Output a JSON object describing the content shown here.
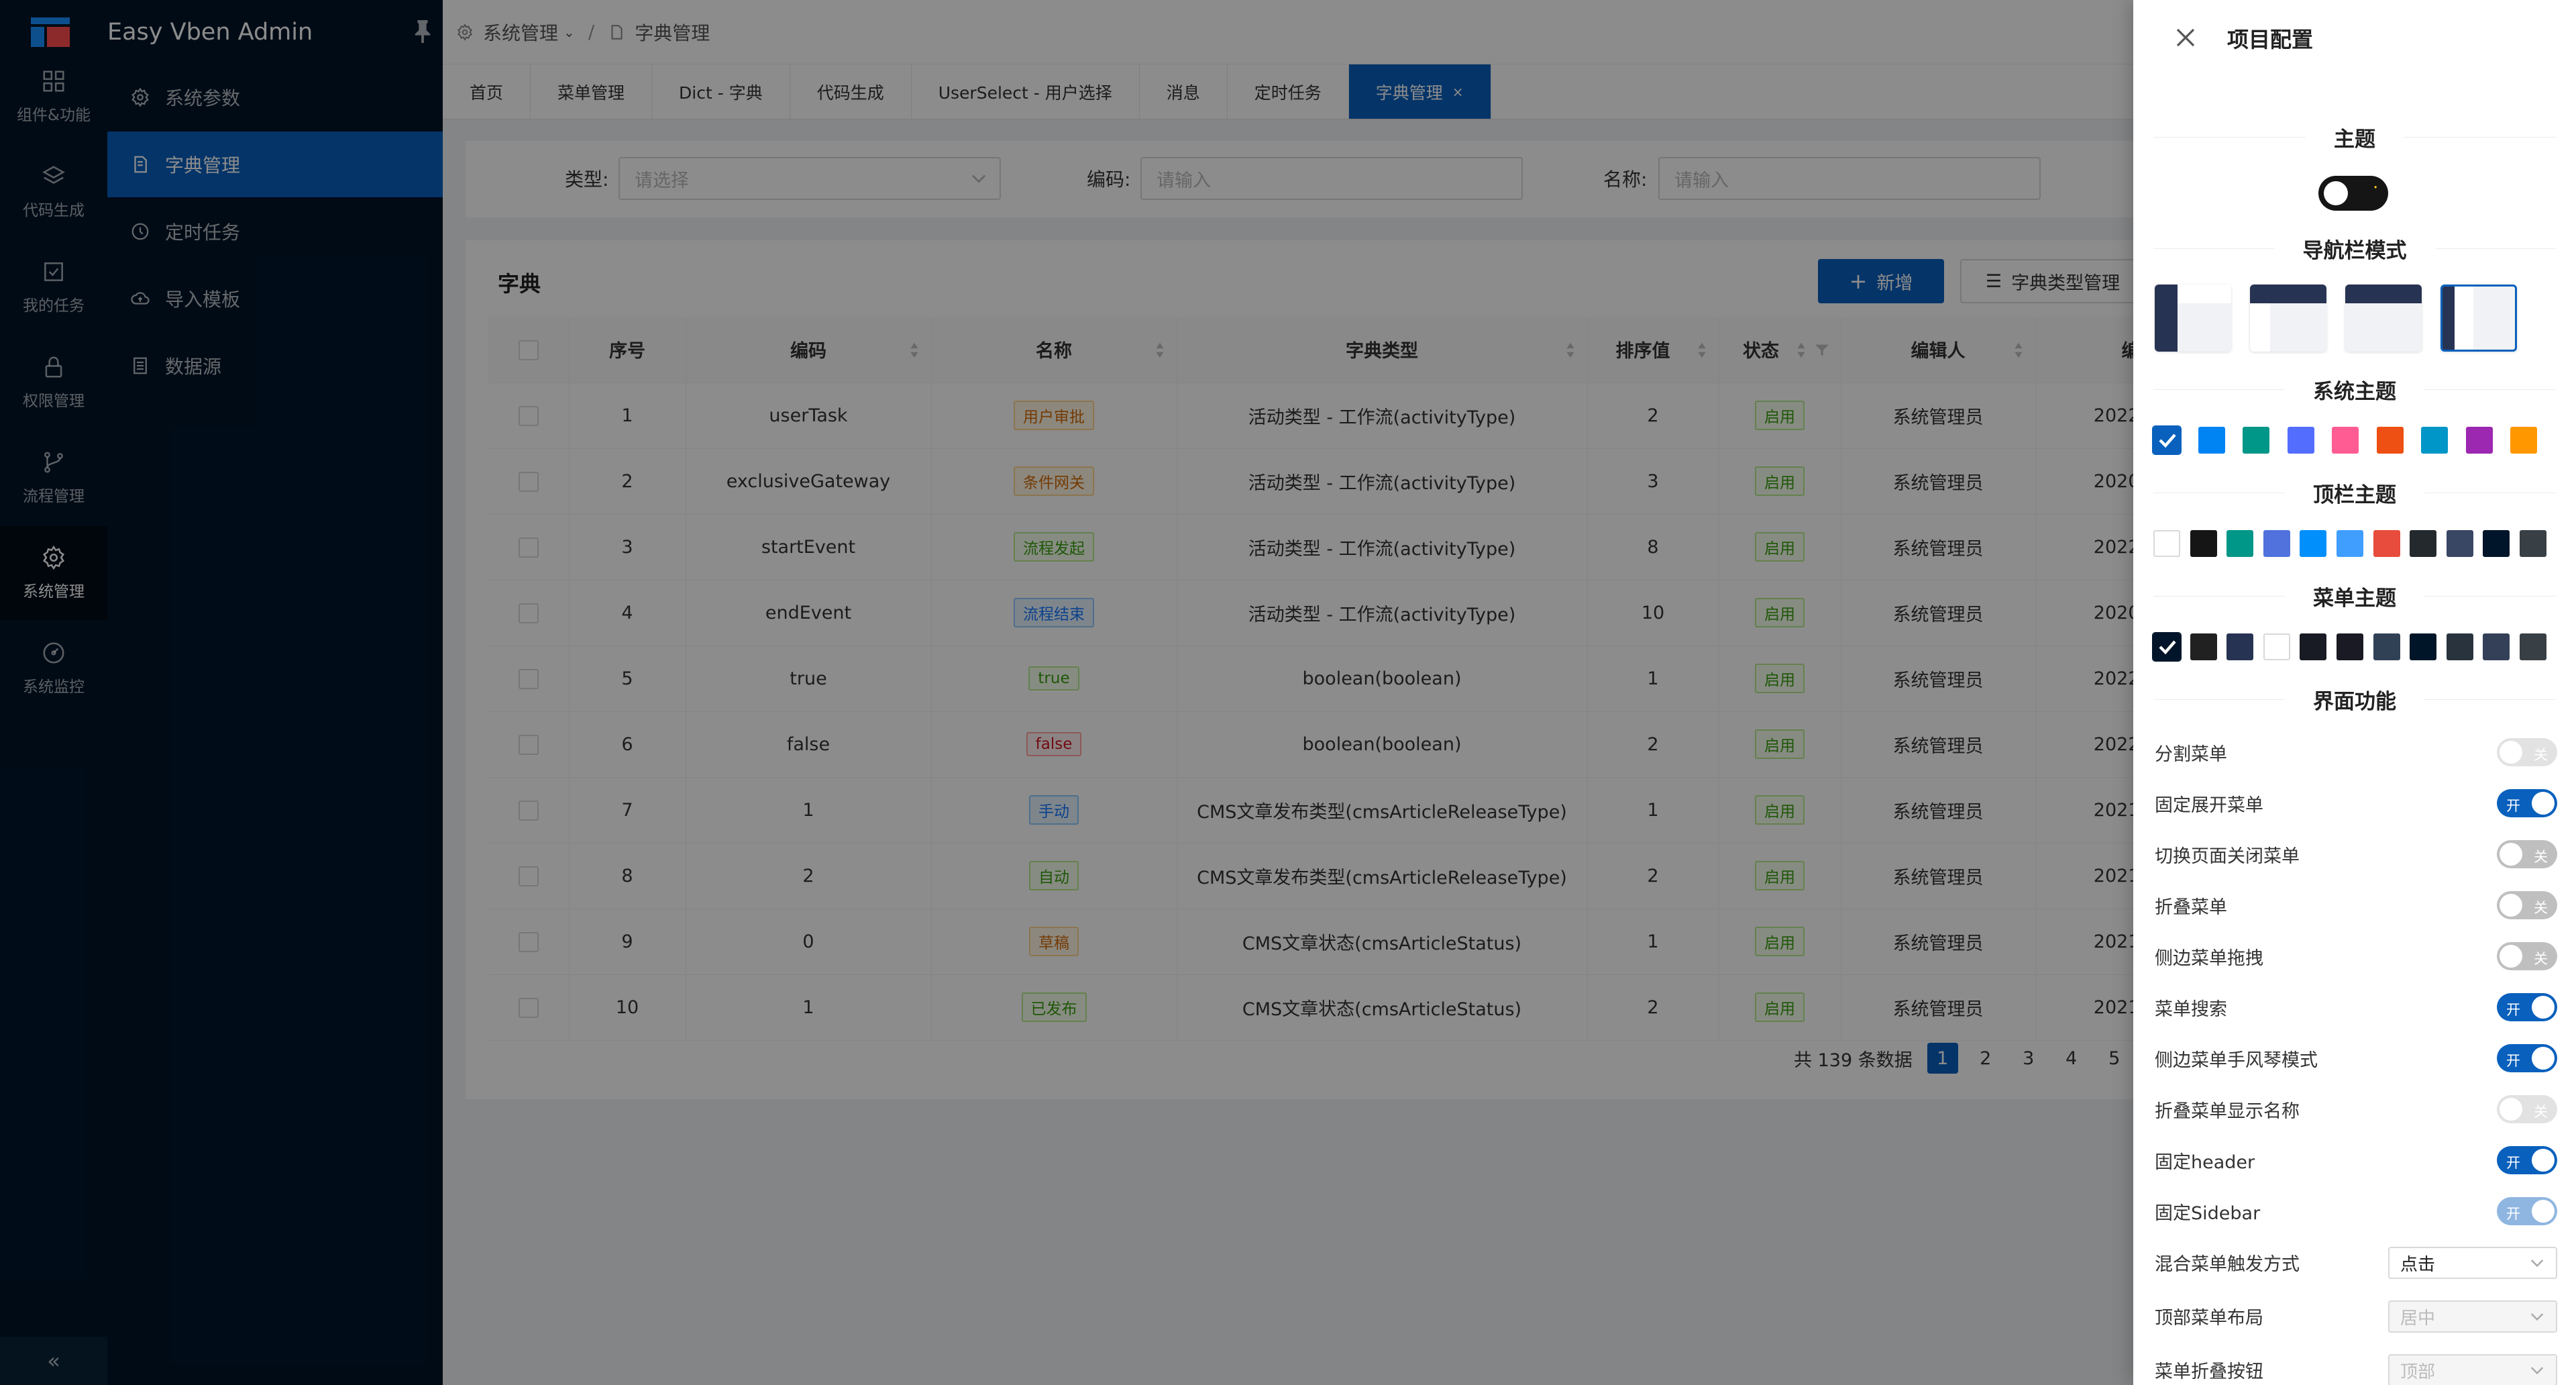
{
  "app": {
    "title": "Easy Vben Admin"
  },
  "rail": [
    {
      "label": "组件&功能",
      "icon": "grid-icon"
    },
    {
      "label": "代码生成",
      "icon": "layers-icon"
    },
    {
      "label": "我的任务",
      "icon": "checkbox-icon"
    },
    {
      "label": "权限管理",
      "icon": "lock-icon"
    },
    {
      "label": "流程管理",
      "icon": "branch-icon"
    },
    {
      "label": "系统管理",
      "icon": "gear-icon"
    },
    {
      "label": "系统监控",
      "icon": "dashboard-icon"
    }
  ],
  "submenu": [
    {
      "label": "系统参数"
    },
    {
      "label": "字典管理"
    },
    {
      "label": "定时任务"
    },
    {
      "label": "导入模板"
    },
    {
      "label": "数据源"
    }
  ],
  "breadcrumb": {
    "parent": "系统管理",
    "current": "字典管理",
    "separator": "/"
  },
  "tabs": [
    "首页",
    "菜单管理",
    "Dict - 字典",
    "代码生成",
    "UserSelect - 用户选择",
    "消息",
    "定时任务",
    "字典管理"
  ],
  "search": {
    "type_label": "类型:",
    "type_placeholder": "请选择",
    "code_label": "编码:",
    "code_placeholder": "请输入",
    "name_label": "名称:",
    "name_placeholder": "请输入"
  },
  "card": {
    "title": "字典",
    "add_button": "新增",
    "type_button": "字典类型管理"
  },
  "table": {
    "headers": [
      "序号",
      "编码",
      "名称",
      "字典类型",
      "排序值",
      "状态",
      "编辑人",
      "编"
    ],
    "rows": [
      {
        "no": "1",
        "code": "userTask",
        "name": "用户审批",
        "tag": "orange",
        "type": "活动类型 - 工作流(activityType)",
        "sort": "2",
        "status": "启用",
        "editor": "系统管理员",
        "date": "2022"
      },
      {
        "no": "2",
        "code": "exclusiveGateway",
        "name": "条件网关",
        "tag": "orange",
        "type": "活动类型 - 工作流(activityType)",
        "sort": "3",
        "status": "启用",
        "editor": "系统管理员",
        "date": "2020"
      },
      {
        "no": "3",
        "code": "startEvent",
        "name": "流程发起",
        "tag": "green",
        "type": "活动类型 - 工作流(activityType)",
        "sort": "8",
        "status": "启用",
        "editor": "系统管理员",
        "date": "2022"
      },
      {
        "no": "4",
        "code": "endEvent",
        "name": "流程结束",
        "tag": "blue",
        "type": "活动类型 - 工作流(activityType)",
        "sort": "10",
        "status": "启用",
        "editor": "系统管理员",
        "date": "2020"
      },
      {
        "no": "5",
        "code": "true",
        "name": "true",
        "tag": "green",
        "type": "boolean(boolean)",
        "sort": "1",
        "status": "启用",
        "editor": "系统管理员",
        "date": "2022"
      },
      {
        "no": "6",
        "code": "false",
        "name": "false",
        "tag": "red",
        "type": "boolean(boolean)",
        "sort": "2",
        "status": "启用",
        "editor": "系统管理员",
        "date": "2022"
      },
      {
        "no": "7",
        "code": "1",
        "name": "手动",
        "tag": "blue",
        "type": "CMS文章发布类型(cmsArticleReleaseType)",
        "sort": "1",
        "status": "启用",
        "editor": "系统管理员",
        "date": "2021"
      },
      {
        "no": "8",
        "code": "2",
        "name": "自动",
        "tag": "green",
        "type": "CMS文章发布类型(cmsArticleReleaseType)",
        "sort": "2",
        "status": "启用",
        "editor": "系统管理员",
        "date": "2021"
      },
      {
        "no": "9",
        "code": "0",
        "name": "草稿",
        "tag": "orange",
        "type": "CMS文章状态(cmsArticleStatus)",
        "sort": "1",
        "status": "启用",
        "editor": "系统管理员",
        "date": "2021"
      },
      {
        "no": "10",
        "code": "1",
        "name": "已发布",
        "tag": "green",
        "type": "CMS文章状态(cmsArticleStatus)",
        "sort": "2",
        "status": "启用",
        "editor": "系统管理员",
        "date": "2021"
      }
    ]
  },
  "pagination": {
    "total": "共 139 条数据",
    "pages": [
      "1",
      "2",
      "3",
      "4",
      "5"
    ],
    "current": "1"
  },
  "drawer": {
    "title": "项目配置",
    "sections": {
      "theme": "主题",
      "nav_mode": "导航栏模式",
      "system_theme": "系统主题",
      "header_theme": "顶栏主题",
      "menu_theme": "菜单主题",
      "features": "界面功能"
    },
    "system_colors": [
      "#0960bd",
      "#0084f4",
      "#009688",
      "#536dfe",
      "#ff5c93",
      "#ee4f12",
      "#0096c7",
      "#9c27b0",
      "#ff9800"
    ],
    "header_colors": [
      "#ffffff",
      "#151515",
      "#009688",
      "#5172dc",
      "#018ffb",
      "#409eff",
      "#e74c3c",
      "#24292e",
      "#394664",
      "#001529",
      "#383f45"
    ],
    "menu_colors": [
      "#001529",
      "#212121",
      "#273352",
      "#ffffff",
      "#191b24",
      "#191a23",
      "#304156",
      "#001628",
      "#28333e",
      "#344058",
      "#383f45"
    ],
    "options": [
      {
        "label": "分割菜单",
        "state": "关",
        "on": false,
        "disabled": true
      },
      {
        "label": "固定展开菜单",
        "state": "开",
        "on": true,
        "disabled": false
      },
      {
        "label": "切换页面关闭菜单",
        "state": "关",
        "on": false,
        "disabled": false
      },
      {
        "label": "折叠菜单",
        "state": "关",
        "on": false,
        "disabled": false
      },
      {
        "label": "侧边菜单拖拽",
        "state": "关",
        "on": false,
        "disabled": false
      },
      {
        "label": "菜单搜索",
        "state": "开",
        "on": true,
        "disabled": false
      },
      {
        "label": "侧边菜单手风琴模式",
        "state": "开",
        "on": true,
        "disabled": false
      },
      {
        "label": "折叠菜单显示名称",
        "state": "关",
        "on": false,
        "disabled": true
      },
      {
        "label": "固定header",
        "state": "开",
        "on": true,
        "disabled": false
      },
      {
        "label": "固定Sidebar",
        "state": "开",
        "on": true,
        "disabled": true
      }
    ],
    "selects": [
      {
        "label": "混合菜单触发方式",
        "value": "点击",
        "disabled": false
      },
      {
        "label": "顶部菜单布局",
        "value": "居中",
        "disabled": true
      },
      {
        "label": "菜单折叠按钮",
        "value": "顶部",
        "disabled": true
      }
    ]
  }
}
